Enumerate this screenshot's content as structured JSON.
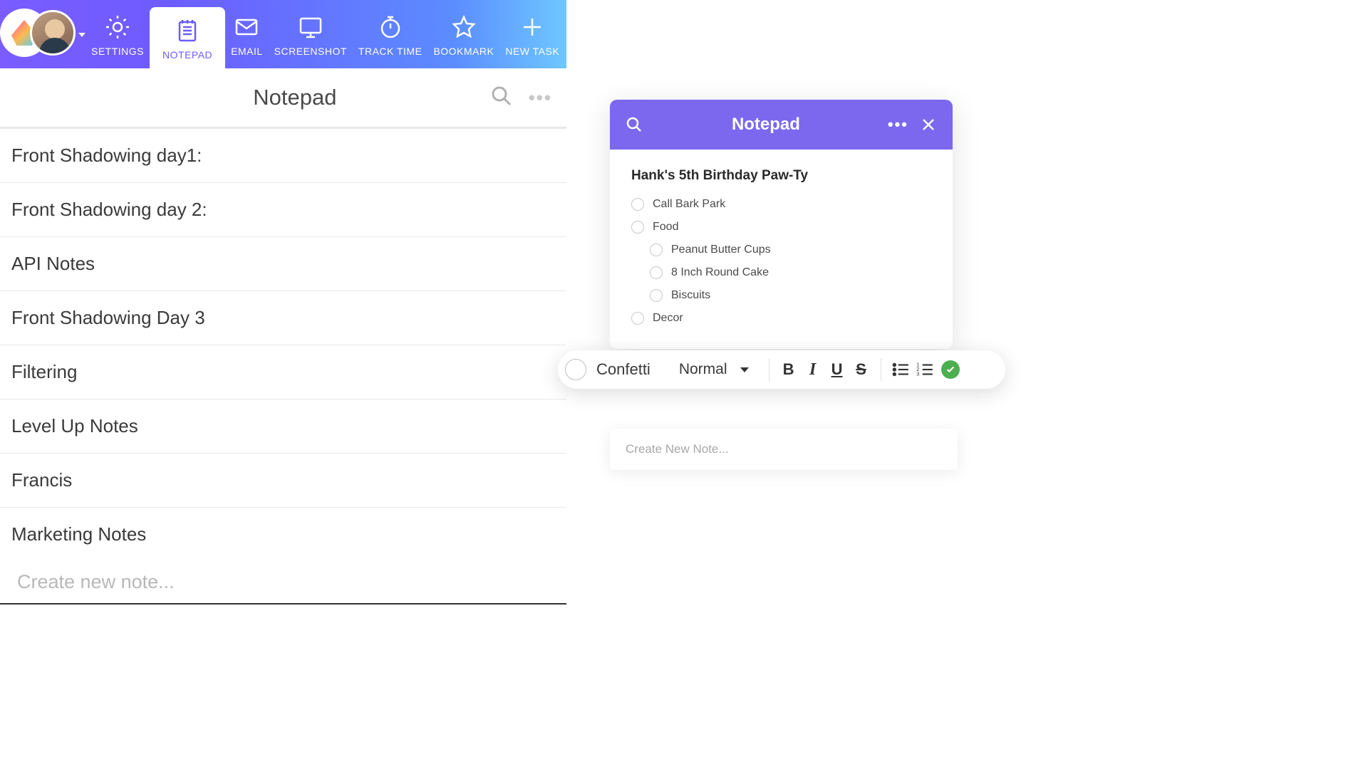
{
  "nav": {
    "settings": "SETTINGS",
    "notepad": "NOTEPAD",
    "email": "EMAIL",
    "screenshot": "SCREENSHOT",
    "tracktime": "TRACK TIME",
    "bookmark": "BOOKMARK",
    "newtask": "NEW TASK"
  },
  "left": {
    "title": "Notepad",
    "notes": [
      "Front Shadowing day1:",
      "Front Shadowing day 2:",
      "API Notes",
      "Front Shadowing Day 3",
      "Filtering",
      "Level Up Notes",
      "Francis",
      "Marketing Notes"
    ],
    "create_placeholder": "Create new note..."
  },
  "right": {
    "title": "Notepad",
    "note_title": "Hank's 5th Birthday Paw-Ty",
    "items": {
      "call": "Call Bark Park",
      "food": "Food",
      "food_children": [
        "Peanut Butter Cups",
        "8 Inch Round Cake",
        "Biscuits"
      ],
      "decor": "Decor"
    },
    "create_placeholder": "Create New Note..."
  },
  "toolbar": {
    "item_text": "Confetti",
    "style_select": "Normal"
  }
}
